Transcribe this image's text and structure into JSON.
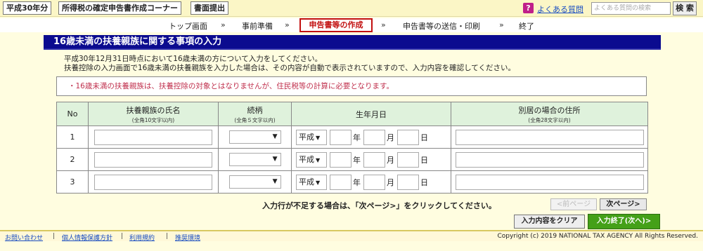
{
  "header": {
    "tags": [
      "平成30年分",
      "所得税の確定申告書作成コーナー",
      "書面提出"
    ],
    "faq_label": "よくある質問",
    "search_placeholder": "よくある質問の検索",
    "search_button": "検 索"
  },
  "steps": {
    "items": [
      "トップ画面",
      "事前準備",
      "申告書等の作成",
      "申告書等の送信・印刷",
      "終了"
    ],
    "current_index": 2,
    "separator": "»"
  },
  "page": {
    "title": "16歳未満の扶養親族に関する事項の入力",
    "intro_line1": "平成30年12月31日時点において16歳未満の方について入力をしてください。",
    "intro_line2": "扶養控除の入力画面で16歳未満の扶養親族を入力した場合は、その内容が自動で表示されていますので、入力内容を確認してください。",
    "notice": "・16歳未満の扶養親族は、扶養控除の対象とはなりませんが、住民税等の計算に必要となります。"
  },
  "table": {
    "headers": {
      "no": "No",
      "name": "扶養親族の氏名",
      "name_note": "(全角10文字以内)",
      "relation": "続柄",
      "relation_note": "(全角５文字以内)",
      "birth": "生年月日",
      "address": "別居の場合の住所",
      "address_note": "(全角28文字以内)"
    },
    "rows": [
      {
        "no": "1",
        "name": "",
        "relation": "",
        "era": "平成",
        "year": "",
        "month": "",
        "day": "",
        "address": ""
      },
      {
        "no": "2",
        "name": "",
        "relation": "",
        "era": "平成",
        "year": "",
        "month": "",
        "day": "",
        "address": ""
      },
      {
        "no": "3",
        "name": "",
        "relation": "",
        "era": "平成",
        "year": "",
        "month": "",
        "day": "",
        "address": ""
      }
    ],
    "year_label": "年",
    "month_label": "月",
    "day_label": "日",
    "dropdown_glyph": "▼"
  },
  "actions": {
    "more_rows_note": "入力行が不足する場合は、「次ページ>」をクリックしてください。",
    "prev_page": "<前ページ",
    "next_page": "次ページ>",
    "clear": "入力内容をクリア",
    "done": "入力終了(次へ)>"
  },
  "footer": {
    "links": [
      "お問い合わせ",
      "個人情報保護方針",
      "利用規約",
      "推奨環境"
    ],
    "copyright": "Copyright (c) 2019 NATIONAL TAX AGENCY All Rights Reserved."
  },
  "colors": {
    "title_bar": "#0b0b8f",
    "current_step": "#c21010",
    "notice_text": "#c0304d",
    "header_cell": "#dff2dc",
    "done_button": "#44a018"
  }
}
